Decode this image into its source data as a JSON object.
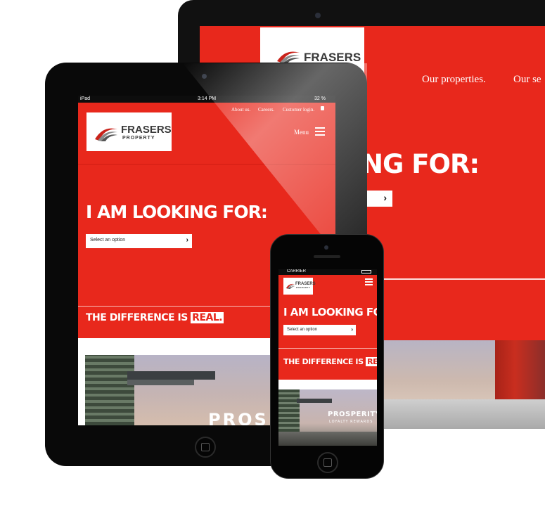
{
  "brand": {
    "name": "FRASERS",
    "sub": "PROPERTY",
    "accent": "#e8281c"
  },
  "laptop": {
    "nav": [
      "Our properties.",
      "Our se"
    ],
    "hero": "NG FOR:"
  },
  "tablet": {
    "status": {
      "carrier": "iPad",
      "time": "3:14 PM",
      "battery": "32 %"
    },
    "top_links": [
      "About us.",
      "Careers.",
      "Customer login."
    ],
    "menu_label": "Menu",
    "hero": "I AM LOOKING FOR:",
    "select_label": "Select an option",
    "difference_text": "THE DIFFERENCE IS",
    "difference_highlight": "REAL.",
    "banner_text": "PROSPE"
  },
  "phone": {
    "status": {
      "carrier": "CARRIER"
    },
    "hero": "I AM LOOKING FOR:",
    "select_label": "Select an option",
    "difference_text": "THE DIFFERENCE IS",
    "difference_highlight": "REAL.",
    "banner_title": "PROSPERITY",
    "banner_sub": "LOYALTY REWARDS"
  }
}
